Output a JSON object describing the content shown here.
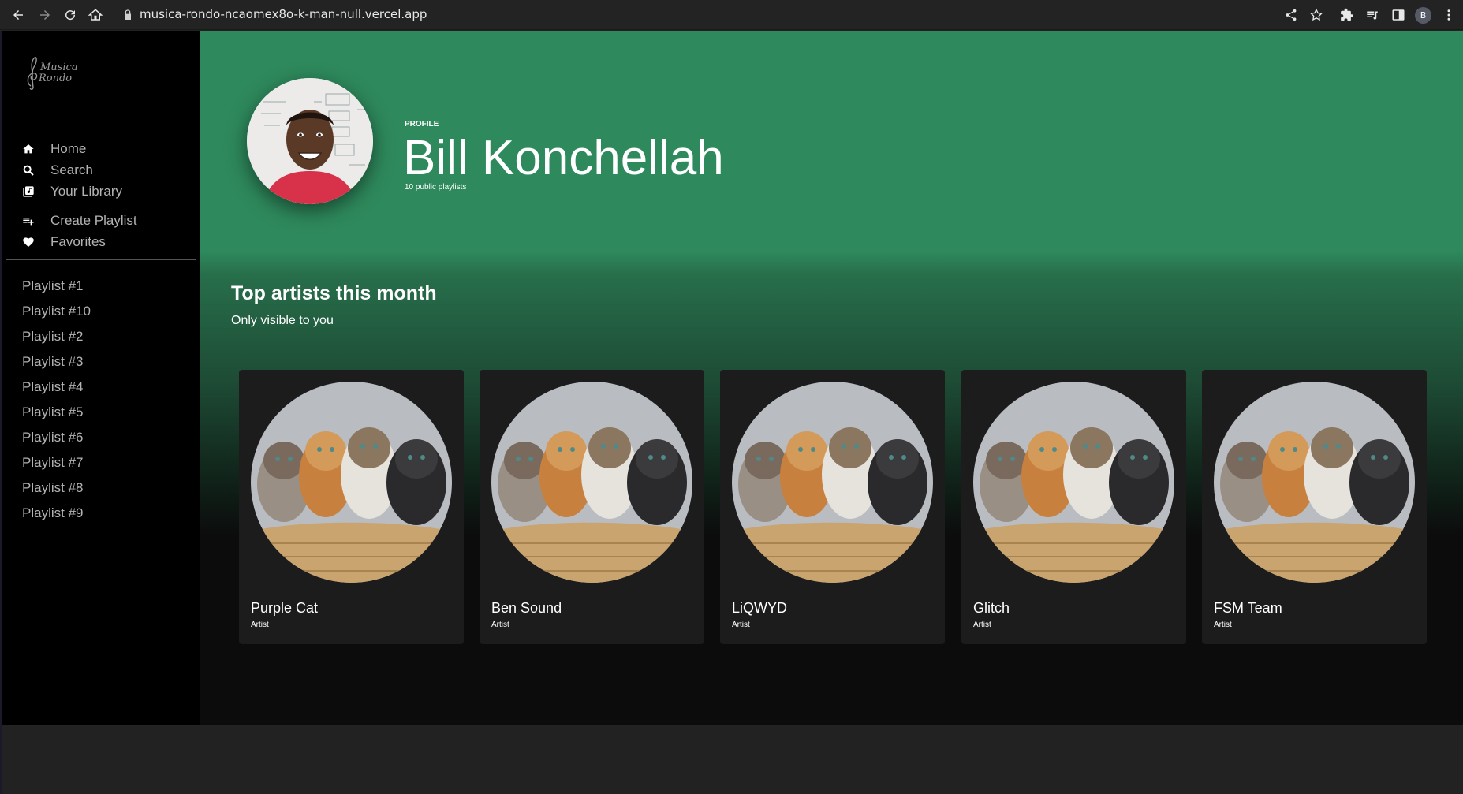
{
  "browser": {
    "url": "musica-rondo-ncaomex8o-k-man-null.vercel.app",
    "profile_initial": "B"
  },
  "sidebar": {
    "logo_text": "Musica Rondo",
    "menu": [
      {
        "label": "Home",
        "icon": "home-icon"
      },
      {
        "label": "Search",
        "icon": "search-icon"
      },
      {
        "label": "Your Library",
        "icon": "library-icon"
      },
      {
        "label": "Create Playlist",
        "icon": "playlist-add-icon"
      },
      {
        "label": "Favorites",
        "icon": "heart-icon"
      }
    ],
    "playlists": [
      "Playlist #1",
      "Playlist #10",
      "Playlist #2",
      "Playlist #3",
      "Playlist #4",
      "Playlist #5",
      "Playlist #6",
      "Playlist #7",
      "Playlist #8",
      "Playlist #9"
    ]
  },
  "profile": {
    "label": "PROFILE",
    "name": "Bill Konchellah",
    "subtitle": "10 public playlists"
  },
  "top_artists": {
    "title": "Top artists this month",
    "subtitle": "Only visible to you",
    "artists": [
      {
        "name": "Purple Cat",
        "type": "Artist"
      },
      {
        "name": "Ben Sound",
        "type": "Artist"
      },
      {
        "name": "LiQWYD",
        "type": "Artist"
      },
      {
        "name": "Glitch",
        "type": "Artist"
      },
      {
        "name": "FSM Team",
        "type": "Artist"
      }
    ]
  },
  "colors": {
    "header_green": "#2e895c",
    "sidebar_bg": "#000000",
    "card_bg": "#1c1c1c"
  }
}
